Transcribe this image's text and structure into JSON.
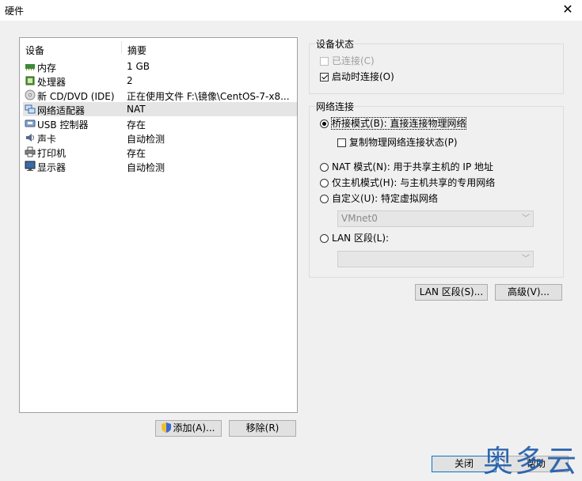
{
  "window": {
    "title": "硬件"
  },
  "device_list": {
    "col_device": "设备",
    "col_summary": "摘要",
    "rows": [
      {
        "name": "内存",
        "summary": "1 GB",
        "icon": "memory-icon"
      },
      {
        "name": "处理器",
        "summary": "2",
        "icon": "processor-icon"
      },
      {
        "name": "新 CD/DVD (IDE)",
        "summary": "正在使用文件 F:\\镜像\\CentOS-7-x8...",
        "icon": "cd-dvd-icon"
      },
      {
        "name": "网络适配器",
        "summary": "NAT",
        "icon": "network-adapter-icon",
        "selected": true
      },
      {
        "name": "USB 控制器",
        "summary": "存在",
        "icon": "usb-icon"
      },
      {
        "name": "声卡",
        "summary": "自动检测",
        "icon": "sound-card-icon"
      },
      {
        "name": "打印机",
        "summary": "存在",
        "icon": "printer-icon"
      },
      {
        "name": "显示器",
        "summary": "自动检测",
        "icon": "display-icon"
      }
    ]
  },
  "buttons": {
    "add": "添加(A)...",
    "remove": "移除(R)",
    "lan_segments": "LAN 区段(S)...",
    "advanced": "高级(V)...",
    "close": "关闭",
    "help": "帮助"
  },
  "device_status": {
    "title": "设备状态",
    "connected": "已连接(C)",
    "connect_at_power_on": "启动时连接(O)"
  },
  "network_connection": {
    "title": "网络连接",
    "bridged": "桥接模式(B): 直接连接物理网络",
    "replicate": "复制物理网络连接状态(P)",
    "nat": "NAT 模式(N): 用于共享主机的 IP 地址",
    "host_only": "仅主机模式(H): 与主机共享的专用网络",
    "custom": "自定义(U): 特定虚拟网络",
    "vmnet_value": "VMnet0",
    "lan_segment": "LAN 区段(L):",
    "lan_value": ""
  },
  "watermark": "奥多云"
}
